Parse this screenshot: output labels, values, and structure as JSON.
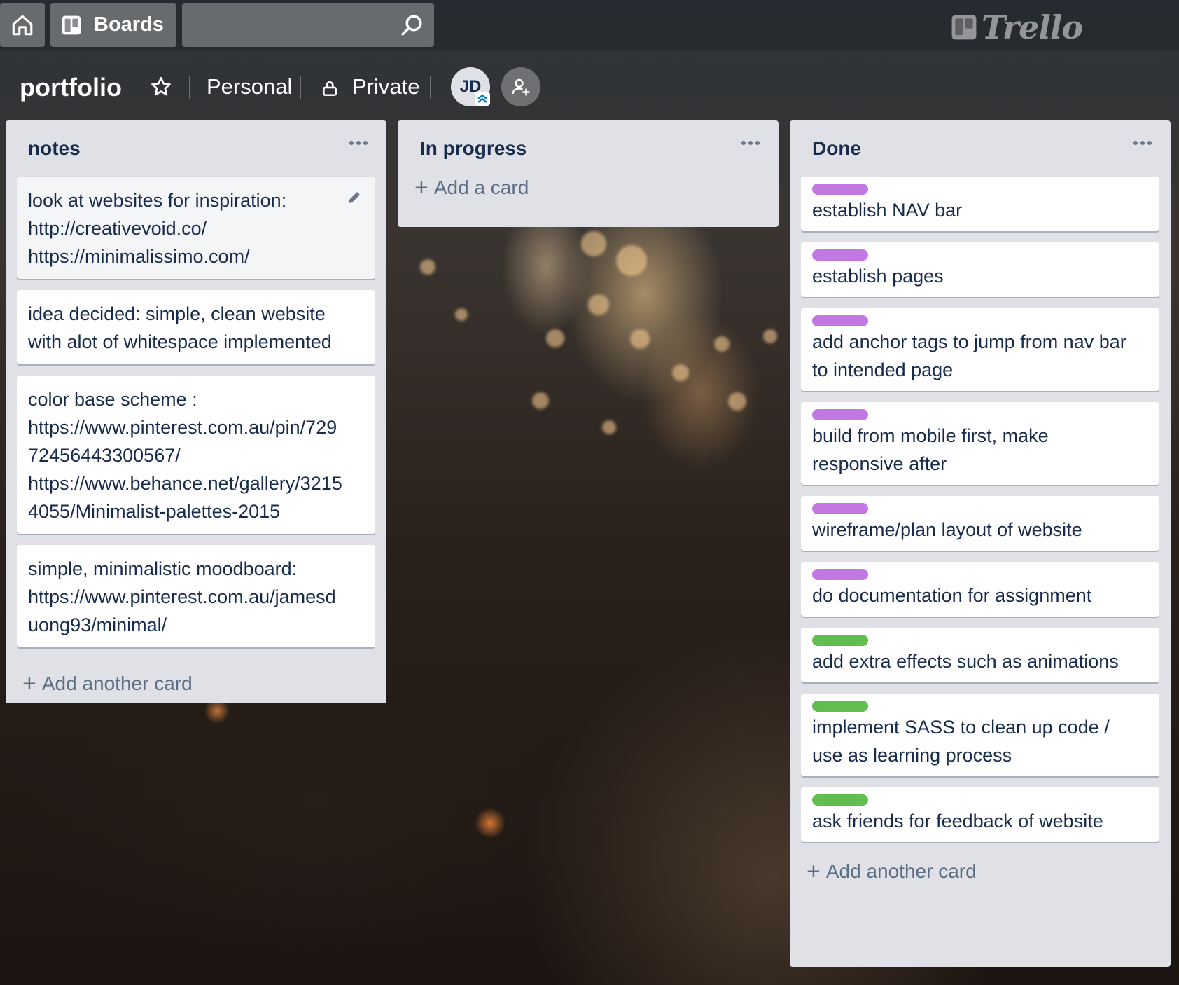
{
  "header": {
    "boards_label": "Boards",
    "search_placeholder": "",
    "logo_text": "Trello"
  },
  "board": {
    "title": "portfolio",
    "team": "Personal",
    "visibility": "Private",
    "member_initials": "JD"
  },
  "lists": {
    "notes": {
      "title": "notes",
      "cards": [
        {
          "lines": [
            "look at websites for inspiration:",
            "http://creativevoid.co/",
            "https://minimalissimo.com/"
          ]
        },
        {
          "lines": [
            "idea decided: simple, clean website",
            "with alot of whitespace implemented"
          ]
        },
        {
          "lines": [
            "color base scheme :",
            "https://www.pinterest.com.au/pin/729",
            "72456443300567/",
            "https://www.behance.net/gallery/3215",
            "4055/Minimalist-palettes-2015"
          ]
        },
        {
          "lines": [
            "simple, minimalistic moodboard:",
            "https://www.pinterest.com.au/jamesd",
            "uong93/minimal/"
          ]
        }
      ],
      "add_label": "Add another card"
    },
    "in_progress": {
      "title": "In progress",
      "add_label": "Add a card"
    },
    "done": {
      "title": "Done",
      "cards": [
        {
          "label_color": "#c377e0",
          "lines": [
            "establish NAV bar"
          ]
        },
        {
          "label_color": "#c377e0",
          "lines": [
            "establish pages"
          ]
        },
        {
          "label_color": "#c377e0",
          "lines": [
            "add anchor tags to jump from nav bar",
            "to intended page"
          ]
        },
        {
          "label_color": "#c377e0",
          "lines": [
            "build from mobile first, make",
            "responsive after"
          ]
        },
        {
          "label_color": "#c377e0",
          "lines": [
            "wireframe/plan layout of website"
          ]
        },
        {
          "label_color": "#c377e0",
          "lines": [
            "do documentation for assignment"
          ]
        },
        {
          "label_color": "#61bd4f",
          "lines": [
            "add extra effects such as animations"
          ]
        },
        {
          "label_color": "#61bd4f",
          "lines": [
            "implement SASS to clean up code /",
            "use as learning process"
          ]
        },
        {
          "label_color": "#61bd4f",
          "lines": [
            "ask friends for feedback of website"
          ]
        }
      ],
      "add_label": "Add another card"
    }
  },
  "icons": {
    "home": "home-icon",
    "boards": "boards-icon",
    "search": "search-icon",
    "star": "star-icon",
    "lock": "lock-icon",
    "invite": "add-member-icon",
    "menu": "ellipsis-icon",
    "edit": "pencil-icon",
    "add": "plus-icon"
  }
}
